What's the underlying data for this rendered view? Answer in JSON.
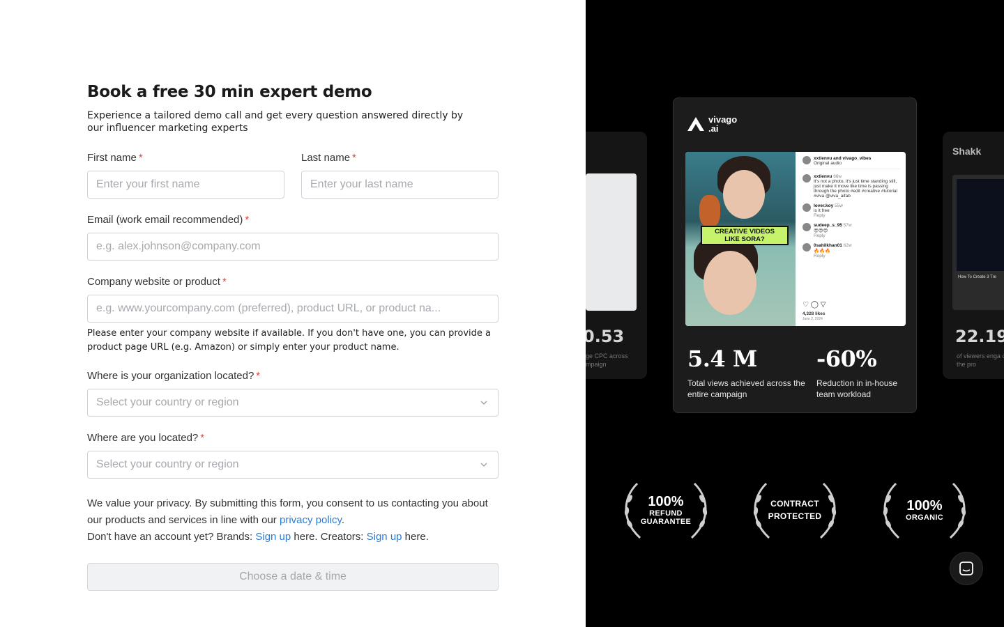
{
  "form": {
    "title": "Book a free 30 min expert demo",
    "subtitle": "Experience a tailored demo call and get every question answered directly by our influencer marketing experts",
    "first_name": {
      "label": "First name",
      "required": "*",
      "placeholder": "Enter your first name"
    },
    "last_name": {
      "label": "Last name",
      "required": "*",
      "placeholder": "Enter your last name"
    },
    "email": {
      "label": "Email (work email recommended)",
      "required": "*",
      "placeholder": "e.g. alex.johnson@company.com"
    },
    "website": {
      "label": "Company website or product",
      "required": "*",
      "placeholder": "e.g. www.yourcompany.com (preferred), product URL, or product na...",
      "hint": "Please enter your company website if available. If you don't have one, you can provide a product page URL (e.g. Amazon) or simply enter your product name."
    },
    "org_location": {
      "label": "Where is your organization located?",
      "required": "*",
      "placeholder": "Select your country or region"
    },
    "your_location": {
      "label": "Where are you located?",
      "required": "*",
      "placeholder": "Select your country or region"
    },
    "privacy": {
      "text_1": "We value your privacy. By submitting this form, you consent to us contacting you about our products and services in line with our ",
      "policy_link": "privacy policy",
      "text_2": ".",
      "account_text": "Don't have an account yet? Brands: ",
      "brands_link": "Sign up",
      "creators_text": " here. Creators: ",
      "creators_link": "Sign up",
      "end_text": " here."
    },
    "submit_label": "Choose a date & time"
  },
  "showcase": {
    "brand_line1": "vivago",
    "brand_line2": ".ai",
    "ribbon_line1": "CREATIVE VIDEOS",
    "ribbon_line2": "LIKE SORA?",
    "post": {
      "header_user": "xxtienvu and vivago_vibes",
      "header_sub": "Original audio",
      "caption_user": "xxtienvu",
      "caption_age": "66w",
      "caption": "It's not a photo, it's just time standing still, just make it move like time is passing through the photo #edit #creative #tutorial #viva @viva_aifab",
      "comments": [
        {
          "user": "lover.koy",
          "age": "55w",
          "text": "is it free",
          "reply": "Reply"
        },
        {
          "user": "sudeep_s_95",
          "age": "57w",
          "text": "😍😍😍",
          "reply": "Reply"
        },
        {
          "user": "0sahilkhan01",
          "age": "62w",
          "text": "🔥🔥🔥",
          "reply": "Reply"
        }
      ],
      "likes": "4,328 likes",
      "date": "June 2, 2024"
    },
    "stats": [
      {
        "value": "5.4 M",
        "desc": "Total views achieved across the entire campaign"
      },
      {
        "value": "-60%",
        "desc": "Reduction in in-house team workload"
      }
    ],
    "side_left": {
      "stat": "0.53",
      "desc": "ge CPC across mpaign"
    },
    "side_right": {
      "brand": "Shakk",
      "stat": "22.19",
      "desc": "of viewers enga clicking the pro",
      "video_title": "How To Create 3 Tre"
    },
    "badges": [
      {
        "line1": "100%",
        "line2": "REFUND",
        "line3": "GUARANTEE"
      },
      {
        "line1": "CONTRACT",
        "line2": "PROTECTED",
        "line3": ""
      },
      {
        "line1": "100%",
        "line2": "ORGANIC",
        "line3": ""
      }
    ]
  }
}
